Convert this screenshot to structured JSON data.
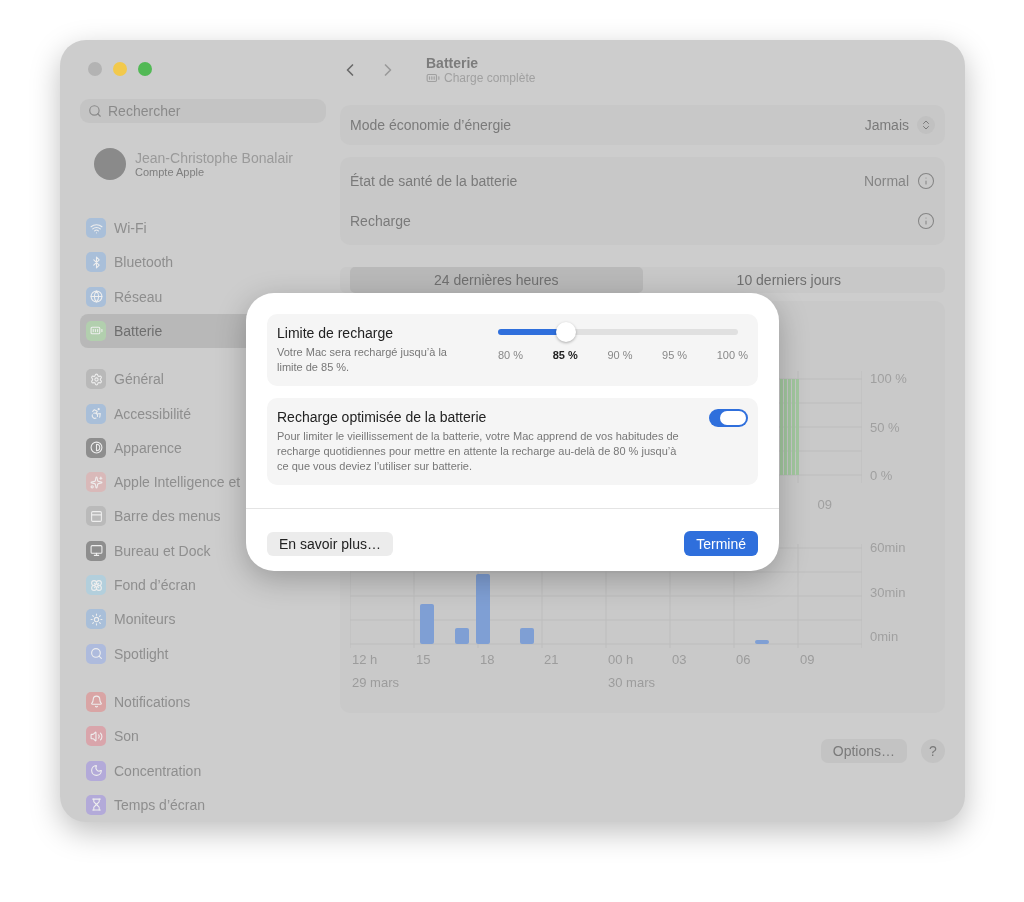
{
  "window": {
    "title": "Batterie",
    "subtitle": "Charge complète"
  },
  "sidebar": {
    "search": {
      "placeholder": "Rechercher"
    },
    "account": {
      "name": "Jean-Christophe Bonalair",
      "subtitle": "Compte Apple"
    },
    "groups": [
      [
        {
          "label": "Wi-Fi",
          "kind": "wifi",
          "color": "#a9bfd9",
          "selected": false
        },
        {
          "label": "Bluetooth",
          "kind": "bluetooth",
          "color": "#a9bfd9",
          "selected": false
        },
        {
          "label": "Réseau",
          "kind": "network",
          "color": "#a9bfd9",
          "selected": false
        },
        {
          "label": "Batterie",
          "kind": "battery",
          "color": "#b2cfae",
          "selected": true
        }
      ],
      [
        {
          "label": "Général",
          "kind": "general",
          "color": "#b9b9b9",
          "selected": false
        },
        {
          "label": "Accessibilité",
          "kind": "accessibility",
          "color": "#a9bfd9",
          "selected": false
        },
        {
          "label": "Apparence",
          "kind": "appearance",
          "color": "#8e8e8e",
          "selected": false
        },
        {
          "label": "Apple Intelligence et",
          "kind": "intelligence",
          "color": "#d9b9b9",
          "selected": false
        },
        {
          "label": "Barre des menus",
          "kind": "menubar",
          "color": "#bababa",
          "selected": false
        },
        {
          "label": "Bureau et Dock",
          "kind": "dock",
          "color": "#8e8e8e",
          "selected": false
        },
        {
          "label": "Fond d’écran",
          "kind": "wallpaper",
          "color": "#b3cfdc",
          "selected": false
        },
        {
          "label": "Moniteurs",
          "kind": "display",
          "color": "#a9bfd9",
          "selected": false
        },
        {
          "label": "Spotlight",
          "kind": "spotlight",
          "color": "#aebbdd",
          "selected": false
        }
      ],
      [
        {
          "label": "Notifications",
          "kind": "notifications",
          "color": "#d9a5a5",
          "selected": false
        },
        {
          "label": "Son",
          "kind": "sound",
          "color": "#d9a5ab",
          "selected": false
        },
        {
          "label": "Concentration",
          "kind": "focus",
          "color": "#b3aad9",
          "selected": false
        },
        {
          "label": "Temps d’écran",
          "kind": "screentime",
          "color": "#b3aad9",
          "selected": false
        }
      ]
    ]
  },
  "settings": [
    {
      "label": "Mode économie d’énergie",
      "value": "Jamais",
      "kind": "popup"
    },
    {
      "label": "État de santé de la batterie",
      "value": "Normal",
      "kind": "info"
    },
    {
      "label": "Recharge",
      "kind": "info"
    }
  ],
  "segments": [
    {
      "label": "24 dernières heures",
      "selected": true
    },
    {
      "label": "10 derniers jours",
      "selected": false
    }
  ],
  "level_chart": {
    "yticks": [
      "100 %",
      "50 %",
      "0 %"
    ],
    "xticks": [
      "09"
    ]
  },
  "usage_chart": {
    "yticks": [
      "60min",
      "30min",
      "0min"
    ],
    "xticks": [
      "12 h",
      "15",
      "18",
      "21",
      "00 h",
      "03",
      "06",
      "09"
    ],
    "dates": [
      "29 mars",
      "30 mars"
    ]
  },
  "footer": {
    "options": "Options…",
    "help": "?"
  },
  "dialog": {
    "limit": {
      "title": "Limite de recharge",
      "description": "Votre Mac sera rechargé jusqu’à la limite de 85 %.",
      "level": 0.25,
      "ticks": [
        {
          "label": "80 %",
          "selected": false
        },
        {
          "label": "85 %",
          "selected": true
        },
        {
          "label": "90 %",
          "selected": false
        },
        {
          "label": "95 %",
          "selected": false
        },
        {
          "label": "100 %",
          "selected": false
        }
      ]
    },
    "optimized": {
      "title": "Recharge optimisée de la batterie",
      "description": "Pour limiter le vieillissement de la batterie, votre Mac apprend de vos habitudes de recharge quotidiennes pour mettre en attente la recharge au-delà de 80 % jusqu’à ce que vous deviez l’utiliser sur batterie.",
      "on": true
    },
    "learn_more": "En savoir plus…",
    "done": "Terminé"
  }
}
